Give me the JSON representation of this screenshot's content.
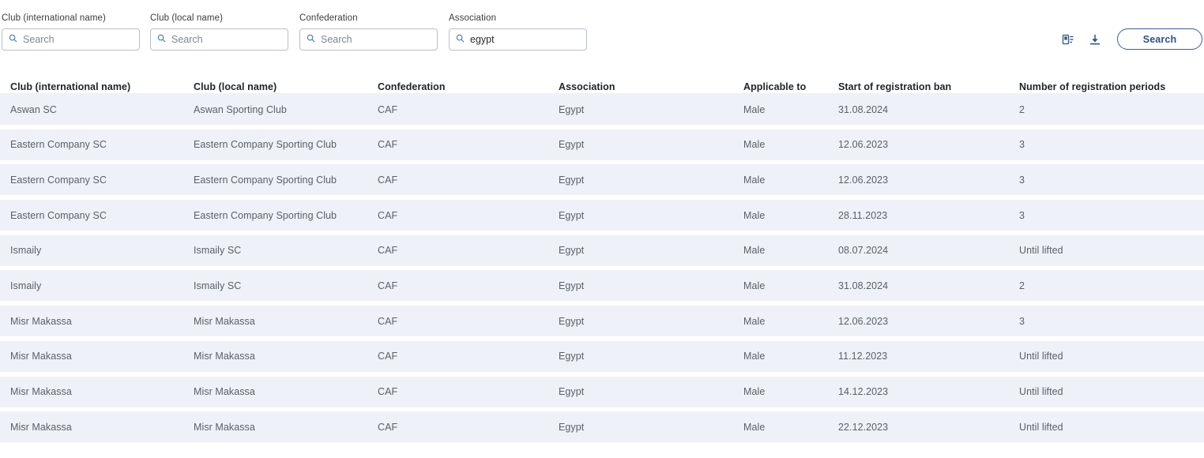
{
  "filters": [
    {
      "id": "club-international-name",
      "label": "Club (international name)",
      "value": "",
      "placeholder": "Search"
    },
    {
      "id": "club-local-name",
      "label": "Club (local name)",
      "value": "",
      "placeholder": "Search"
    },
    {
      "id": "confederation",
      "label": "Confederation",
      "value": "",
      "placeholder": "Search"
    },
    {
      "id": "association",
      "label": "Association",
      "value": "egypt",
      "placeholder": "Search"
    }
  ],
  "toolbar": {
    "copy_icon": "copy-table-icon",
    "download_icon": "download-icon",
    "search_label": "Search"
  },
  "table": {
    "columns": [
      "Club (international name)",
      "Club (local name)",
      "Confederation",
      "Association",
      "Applicable to",
      "Start of registration ban",
      "Number of registration periods"
    ],
    "rows": [
      [
        "Aswan SC",
        "Aswan Sporting Club",
        "CAF",
        "Egypt",
        "Male",
        "31.08.2024",
        "2"
      ],
      [
        "Eastern Company SC",
        "Eastern Company Sporting Club",
        "CAF",
        "Egypt",
        "Male",
        "12.06.2023",
        "3"
      ],
      [
        "Eastern Company SC",
        "Eastern Company Sporting Club",
        "CAF",
        "Egypt",
        "Male",
        "12.06.2023",
        "3"
      ],
      [
        "Eastern Company SC",
        "Eastern Company Sporting Club",
        "CAF",
        "Egypt",
        "Male",
        "28.11.2023",
        "3"
      ],
      [
        "Ismaily",
        "Ismaily SC",
        "CAF",
        "Egypt",
        "Male",
        "08.07.2024",
        "Until lifted"
      ],
      [
        "Ismaily",
        "Ismaily SC",
        "CAF",
        "Egypt",
        "Male",
        "31.08.2024",
        "2"
      ],
      [
        "Misr Makassa",
        "Misr Makassa",
        "CAF",
        "Egypt",
        "Male",
        "12.06.2023",
        "3"
      ],
      [
        "Misr Makassa",
        "Misr Makassa",
        "CAF",
        "Egypt",
        "Male",
        "11.12.2023",
        "Until lifted"
      ],
      [
        "Misr Makassa",
        "Misr Makassa",
        "CAF",
        "Egypt",
        "Male",
        "14.12.2023",
        "Until lifted"
      ],
      [
        "Misr Makassa",
        "Misr Makassa",
        "CAF",
        "Egypt",
        "Male",
        "22.12.2023",
        "Until lifted"
      ]
    ]
  },
  "colors": {
    "row_background": "#eef1f7",
    "accent": "#2d5182",
    "icon_blue": "#3b6ea5"
  }
}
